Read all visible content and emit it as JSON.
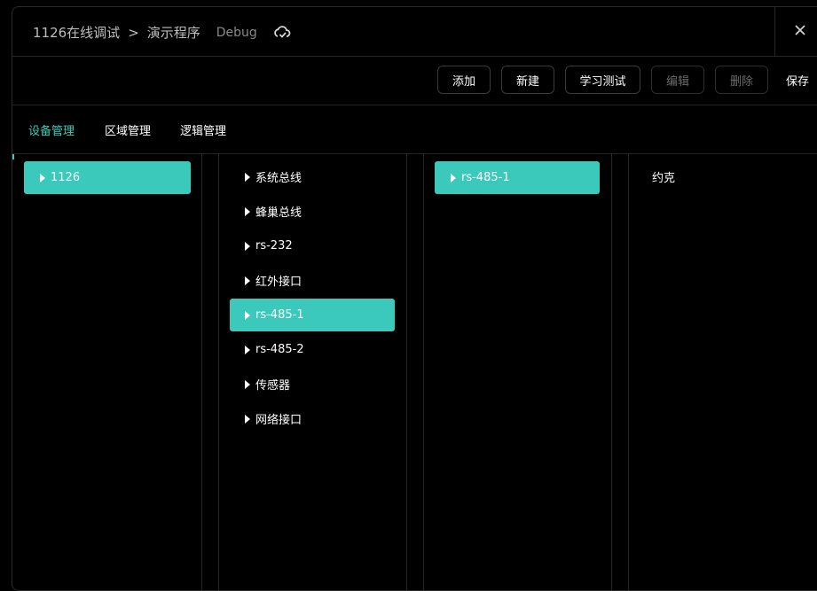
{
  "header": {
    "breadcrumb_root": "1126在线调试",
    "separator": ">",
    "breadcrumb_current": "演示程序",
    "mode": "Debug"
  },
  "toolbar": {
    "add_label": "添加",
    "new_label": "新建",
    "learn_test_label": "学习测试",
    "edit_label": "编辑",
    "delete_label": "删除",
    "save_label": "保存"
  },
  "tabs": [
    {
      "label": "设备管理",
      "active": true
    },
    {
      "label": "区域管理",
      "active": false
    },
    {
      "label": "逻辑管理",
      "active": false
    }
  ],
  "columns": {
    "devices": [
      {
        "label": "1126",
        "selected": true
      }
    ],
    "buses": [
      {
        "label": "系统总线",
        "selected": false
      },
      {
        "label": "蜂巢总线",
        "selected": false
      },
      {
        "label": "rs-232",
        "selected": false
      },
      {
        "label": "红外接口",
        "selected": false
      },
      {
        "label": "rs-485-1",
        "selected": true
      },
      {
        "label": "rs-485-2",
        "selected": false
      },
      {
        "label": "传感器",
        "selected": false
      },
      {
        "label": "网络接口",
        "selected": false
      }
    ],
    "ports": [
      {
        "label": "rs-485-1",
        "selected": true
      }
    ],
    "modules": [
      {
        "label": "约克",
        "selected": false
      }
    ]
  },
  "colors": {
    "accent": "#3ac9bb",
    "active_tab": "#3ecbb8",
    "background": "#000000",
    "border": "#262626"
  }
}
